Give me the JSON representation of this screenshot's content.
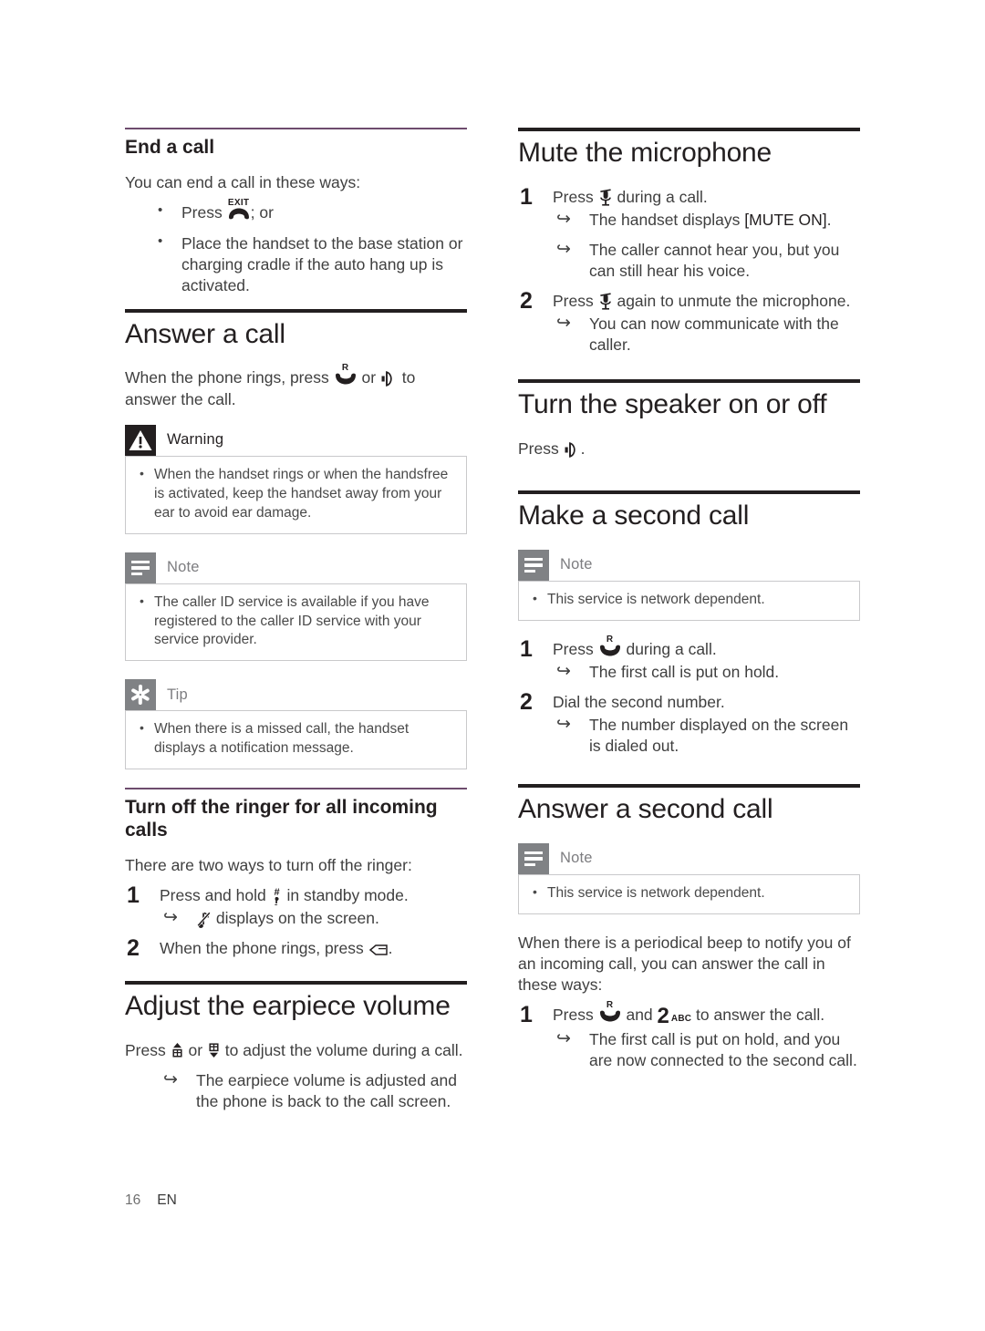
{
  "page": {
    "number": "16",
    "language": "EN"
  },
  "icons": {
    "exit_label": "EXIT",
    "talk_label": "R",
    "key2_label": "2",
    "key2_sub": "ABC",
    "hash_key": "#",
    "names": {
      "hangup": "hangup-handset-icon",
      "talk": "talk-handset-icon",
      "speaker": "speaker-icon",
      "mute": "mute-microphone-icon",
      "ringer_off": "ringer-off-note-icon",
      "volume_up": "volume-up-icon",
      "volume_down": "volume-down-icon",
      "hash": "hash-key-icon",
      "silence": "silence-key-icon"
    }
  },
  "left_column": {
    "end_a_call": {
      "heading": "End a call",
      "intro": "You can end a call in these ways:",
      "bullets": [
        {
          "pre": "Press ",
          "post": "; or"
        },
        {
          "pre": "Place the handset to the base station or charging cradle if the auto hang up is activated.",
          "post": ""
        }
      ]
    },
    "answer_a_call": {
      "heading": "Answer a call",
      "intro_pre": "When the phone rings, press ",
      "intro_mid": " or ",
      "intro_post": " to answer the call.",
      "warning": {
        "title": "Warning",
        "items": [
          "When the handset rings or when the handsfree is activated, keep the handset away from your ear to avoid ear damage."
        ]
      },
      "note": {
        "title": "Note",
        "items": [
          "The caller ID service is available if you have registered to the caller ID service with your service provider."
        ]
      },
      "tip": {
        "title": "Tip",
        "items": [
          "When there is a missed call, the handset displays a notification message."
        ]
      }
    },
    "turn_off_ringer": {
      "heading": "Turn off the ringer for all incoming calls",
      "intro": "There are two ways to turn off the ringer:",
      "step1_pre": "Press and hold ",
      "step1_post": " in standby mode.",
      "step1_result_post": " displays on the screen.",
      "step2_pre": "When the phone rings, press ",
      "step2_post": "."
    },
    "adjust_earpiece": {
      "heading": "Adjust the earpiece volume",
      "line_pre": "Press ",
      "line_mid": " or ",
      "line_post": " to adjust the volume during a call.",
      "result": "The earpiece volume is adjusted and the phone is back to the call screen."
    }
  },
  "right_column": {
    "mute_microphone": {
      "heading": "Mute the microphone",
      "step1_pre": "Press ",
      "step1_post": " during a call.",
      "step1_result_a_pre": "The handset displays ",
      "step1_result_a_bracket": "[MUTE ON]",
      "step1_result_a_post": ".",
      "step1_result_b": "The caller cannot hear you, but you can still hear his voice.",
      "step2_pre": "Press ",
      "step2_post": " again to unmute the microphone.",
      "step2_result": "You can now communicate with the caller."
    },
    "turn_speaker": {
      "heading": "Turn the speaker on or off",
      "line_pre": "Press ",
      "line_post": "."
    },
    "make_second_call": {
      "heading": "Make a second call",
      "note": {
        "title": "Note",
        "items": [
          "This service is network dependent."
        ]
      },
      "step1_pre": "Press ",
      "step1_post": " during a call.",
      "step1_result": "The first call is put on hold.",
      "step2": "Dial the second number.",
      "step2_result": "The number displayed on the screen is dialed out."
    },
    "answer_second_call": {
      "heading": "Answer a second call",
      "note": {
        "title": "Note",
        "items": [
          "This service is network dependent."
        ]
      },
      "intro": "When there is a periodical beep to notify you of an incoming call, you can answer the call in these ways:",
      "step1_pre": "Press ",
      "step1_mid": " and ",
      "step1_post": " to answer the call.",
      "step1_result": "The first call is put on hold, and you are now connected to the second call."
    }
  },
  "colors": {
    "rule_dark": "#231f20",
    "rule_accent": "#6d4b6d",
    "badge_gray": "#808285",
    "badge_dark": "#231f20",
    "text": "#3f3f3f"
  }
}
